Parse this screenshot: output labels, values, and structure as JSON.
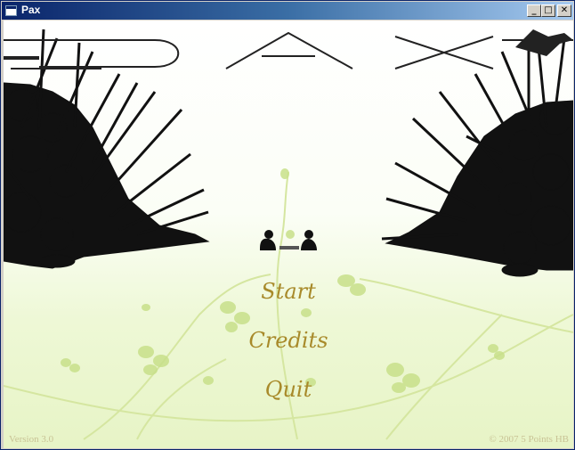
{
  "window": {
    "title": "Pax",
    "minimize_glyph": "_",
    "maximize_glyph": "□",
    "close_glyph": "✕"
  },
  "menu": {
    "start": "Start",
    "credits": "Credits",
    "quit": "Quit"
  },
  "footer": {
    "version": "Version 3.0",
    "copyright": "© 2007 5 Points HB"
  },
  "colors": {
    "menu_text": "#a88a2a",
    "footer_text": "#c9c396",
    "vine": "#d5e6a0",
    "leaf": "#c8e08a",
    "silhouette": "#111111",
    "titlebar_start": "#0a246a"
  },
  "icons": [
    "window-icon",
    "minimize-icon",
    "maximize-icon",
    "close-icon"
  ]
}
